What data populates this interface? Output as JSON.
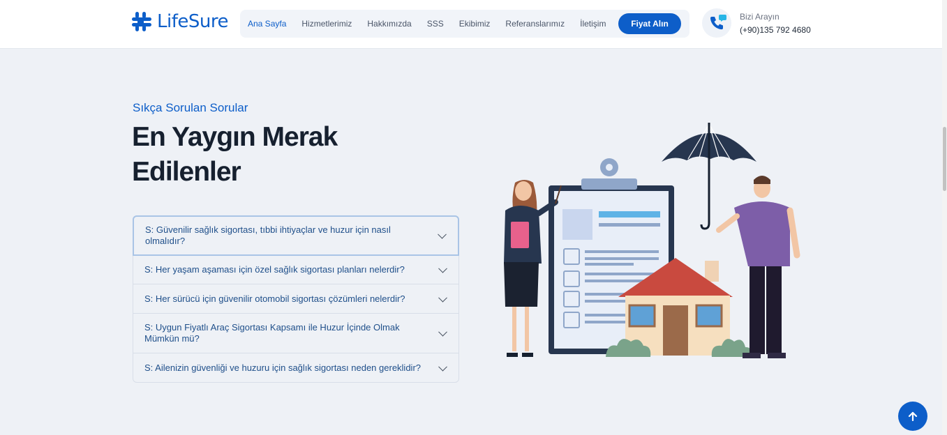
{
  "header": {
    "brand": "LifeSure",
    "nav": [
      {
        "label": "Ana Sayfa",
        "active": true
      },
      {
        "label": "Hizmetlerimiz",
        "active": false
      },
      {
        "label": "Hakkımızda",
        "active": false
      },
      {
        "label": "SSS",
        "active": false
      },
      {
        "label": "Ekibimiz",
        "active": false
      },
      {
        "label": "Referanslarımız",
        "active": false
      },
      {
        "label": "İletişim",
        "active": false
      }
    ],
    "cta_label": "Fiyat Alın",
    "call_label": "Bizi Arayın",
    "call_number": "(+90)135 792 4680"
  },
  "faq_section": {
    "eyebrow": "Sıkça Sorulan Sorular",
    "heading": "En Yaygın Merak Edilenler",
    "items": [
      {
        "question": "S: Güvenilir sağlık sigortası, tıbbi ihtiyaçlar ve huzur için nasıl olmalıdır?"
      },
      {
        "question": "S: Her yaşam aşaması için özel sağlık sigortası planları nelerdir?"
      },
      {
        "question": "S: Her sürücü için güvenilir otomobil sigortası çözümleri nelerdir?"
      },
      {
        "question": "S: Uygun Fiyatlı Araç Sigortası Kapsamı ile Huzur İçinde Olmak Mümkün mü?"
      },
      {
        "question": "S: Ailenizin güvenliği ve huzuru için sağlık sigortası neden gereklidir?"
      }
    ]
  },
  "colors": {
    "accent": "#0d5ec9",
    "heading": "#16202f",
    "question": "#1f4f8a",
    "background": "#eef1f6"
  },
  "icons": [
    "logo-mark-icon",
    "phone-icon",
    "chevron-down-icon",
    "arrow-up-icon"
  ]
}
